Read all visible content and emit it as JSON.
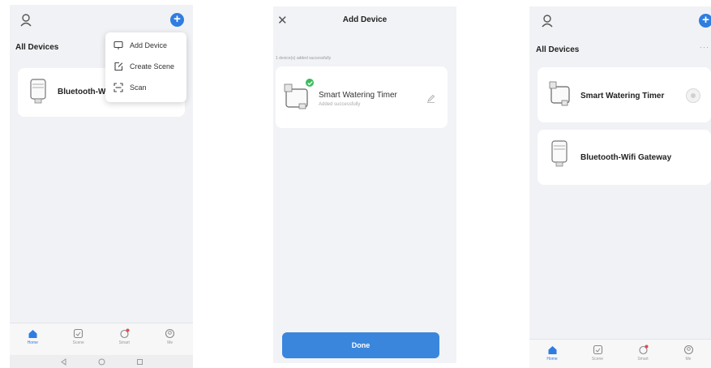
{
  "screen1": {
    "user_icon": "user-icon",
    "add_icon": "plus-icon",
    "section_title": "All Devices",
    "device_name": "Bluetooth-W",
    "popup": [
      {
        "label": "Add Device",
        "icon": "add-device-icon"
      },
      {
        "label": "Create Scene",
        "icon": "create-scene-icon"
      },
      {
        "label": "Scan",
        "icon": "scan-icon"
      }
    ],
    "tabs": [
      {
        "label": "Home",
        "icon": "home-icon",
        "active": true
      },
      {
        "label": "Scene",
        "icon": "scene-icon",
        "active": false
      },
      {
        "label": "Smart",
        "icon": "smart-icon",
        "active": false
      },
      {
        "label": "Me",
        "icon": "me-icon",
        "active": false
      }
    ],
    "nav": [
      "back-icon",
      "home-circle-icon",
      "recents-icon"
    ]
  },
  "screen2": {
    "close_icon": "close-icon",
    "title": "Add Device",
    "added_note": "1 device(s) added successfully",
    "device_name": "Smart Watering Timer",
    "device_status": "Added successfully",
    "edit_icon": "edit-icon",
    "done_label": "Done"
  },
  "screen3": {
    "user_icon": "user-icon",
    "add_icon": "plus-icon",
    "section_title": "All Devices",
    "more": "···",
    "devices": [
      {
        "name": "Smart Watering Timer",
        "icon": "watering-timer-icon"
      },
      {
        "name": "Bluetooth-Wifi Gateway",
        "icon": "gateway-icon"
      }
    ],
    "tabs": [
      {
        "label": "Home",
        "icon": "home-icon",
        "active": true
      },
      {
        "label": "Scene",
        "icon": "scene-icon",
        "active": false
      },
      {
        "label": "Smart",
        "icon": "smart-icon",
        "active": false
      },
      {
        "label": "Me",
        "icon": "me-icon",
        "active": false
      }
    ]
  },
  "colors": {
    "accent": "#2f7de1",
    "badge": "#3dbb5f",
    "background": "#f1f2f5"
  }
}
